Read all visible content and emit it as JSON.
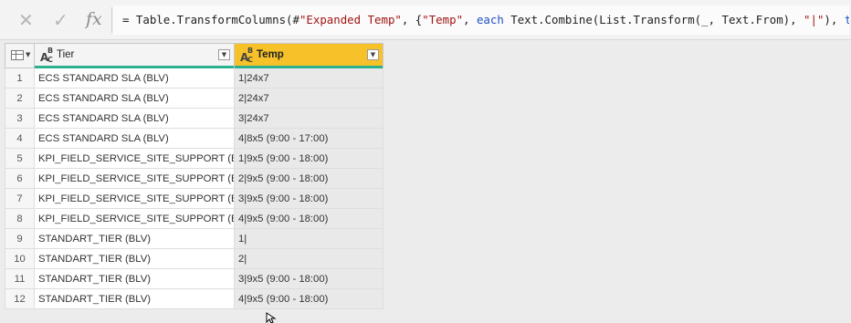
{
  "formula_bar": {
    "cancel_icon": "close-icon",
    "confirm_icon": "check-icon",
    "fx_label": "fx",
    "formula_parts": [
      {
        "text": "= Table.TransformColumns(#",
        "kind": "plain"
      },
      {
        "text": "\"Expanded Temp\"",
        "kind": "str"
      },
      {
        "text": ", {",
        "kind": "plain"
      },
      {
        "text": "\"Temp\"",
        "kind": "str"
      },
      {
        "text": ", ",
        "kind": "plain"
      },
      {
        "text": "each",
        "kind": "kw"
      },
      {
        "text": " Text.Combine(List.Transform(_, Text.From), ",
        "kind": "plain"
      },
      {
        "text": "\"|\"",
        "kind": "str"
      },
      {
        "text": "), ",
        "kind": "plain"
      },
      {
        "text": "type text",
        "kind": "kw"
      },
      {
        "text": "})",
        "kind": "plain"
      }
    ]
  },
  "grid": {
    "columns": [
      {
        "label": "Tier",
        "type_icon": "text-type-icon",
        "selected": false
      },
      {
        "label": "Temp",
        "type_icon": "text-type-icon",
        "selected": true
      }
    ],
    "quality_color": "#2cb18e",
    "selected_header_color": "#f7c12a",
    "rows": [
      {
        "index": "1",
        "tier": "ECS STANDARD SLA (BLV)",
        "temp": "1|24x7"
      },
      {
        "index": "2",
        "tier": "ECS STANDARD SLA (BLV)",
        "temp": "2|24x7"
      },
      {
        "index": "3",
        "tier": "ECS STANDARD SLA (BLV)",
        "temp": "3|24x7"
      },
      {
        "index": "4",
        "tier": "ECS STANDARD SLA (BLV)",
        "temp": "4|8x5 (9:00 - 17:00)"
      },
      {
        "index": "5",
        "tier": "KPI_FIELD_SERVICE_SITE_SUPPORT (BLV)",
        "temp": "1|9x5 (9:00 - 18:00)"
      },
      {
        "index": "6",
        "tier": "KPI_FIELD_SERVICE_SITE_SUPPORT (BLV)",
        "temp": "2|9x5 (9:00 - 18:00)"
      },
      {
        "index": "7",
        "tier": "KPI_FIELD_SERVICE_SITE_SUPPORT (BLV)",
        "temp": "3|9x5 (9:00 - 18:00)"
      },
      {
        "index": "8",
        "tier": "KPI_FIELD_SERVICE_SITE_SUPPORT (BLV)",
        "temp": "4|9x5 (9:00 - 18:00)"
      },
      {
        "index": "9",
        "tier": "STANDART_TIER (BLV)",
        "temp": "1|"
      },
      {
        "index": "10",
        "tier": "STANDART_TIER (BLV)",
        "temp": "2|"
      },
      {
        "index": "11",
        "tier": "STANDART_TIER (BLV)",
        "temp": "3|9x5 (9:00 - 18:00)"
      },
      {
        "index": "12",
        "tier": "STANDART_TIER (BLV)",
        "temp": "4|9x5 (9:00 - 18:00)"
      }
    ]
  }
}
